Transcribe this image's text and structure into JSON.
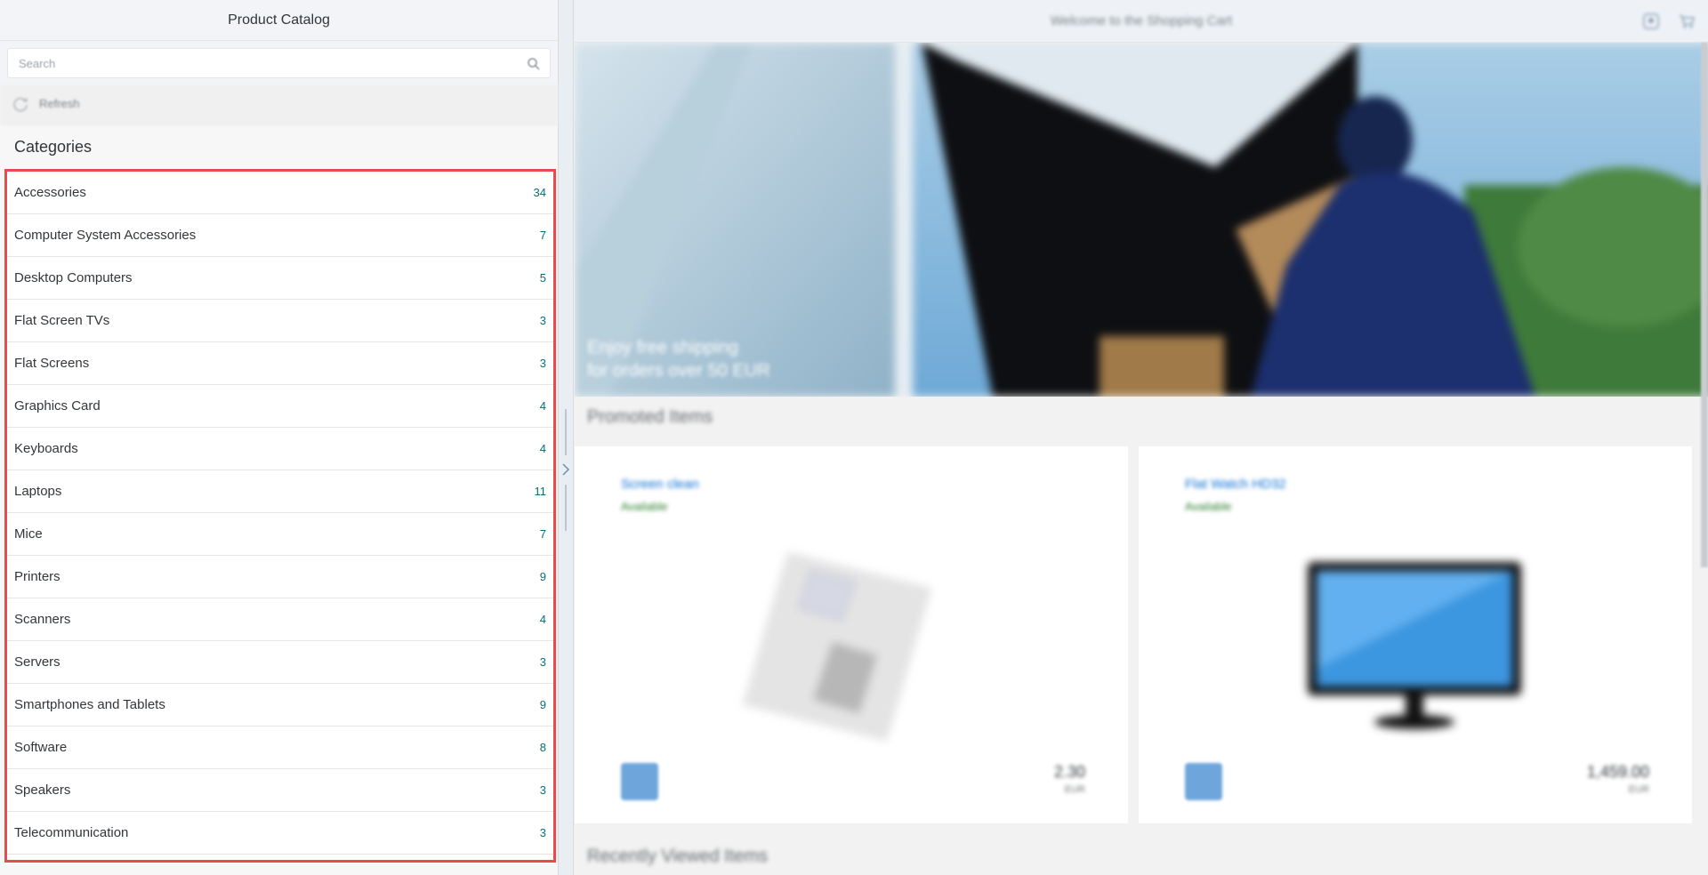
{
  "master": {
    "title": "Product Catalog",
    "search_placeholder": "Search",
    "refresh_label": "Refresh",
    "categories_title": "Categories",
    "categories": [
      {
        "name": "Accessories",
        "count": "34"
      },
      {
        "name": "Computer System Accessories",
        "count": "7"
      },
      {
        "name": "Desktop Computers",
        "count": "5"
      },
      {
        "name": "Flat Screen TVs",
        "count": "3"
      },
      {
        "name": "Flat Screens",
        "count": "3"
      },
      {
        "name": "Graphics Card",
        "count": "4"
      },
      {
        "name": "Keyboards",
        "count": "4"
      },
      {
        "name": "Laptops",
        "count": "11"
      },
      {
        "name": "Mice",
        "count": "7"
      },
      {
        "name": "Printers",
        "count": "9"
      },
      {
        "name": "Scanners",
        "count": "4"
      },
      {
        "name": "Servers",
        "count": "3"
      },
      {
        "name": "Smartphones and Tablets",
        "count": "9"
      },
      {
        "name": "Software",
        "count": "8"
      },
      {
        "name": "Speakers",
        "count": "3"
      },
      {
        "name": "Telecommunication",
        "count": "3"
      }
    ]
  },
  "detail": {
    "title": "Welcome to the Shopping Cart",
    "hero_text_line1": "Enjoy free shipping",
    "hero_text_line2": "for orders over 50 EUR",
    "promoted_title": "Promoted Items",
    "recent_title": "Recently Viewed Items",
    "cards": [
      {
        "title": "Screen clean",
        "status": "Available",
        "price": "2.30",
        "currency": "EUR"
      },
      {
        "title": "Flat Watch HD32",
        "status": "Available",
        "price": "1,459.00",
        "currency": "EUR"
      }
    ]
  },
  "colors": {
    "highlight_border": "#e74c4c",
    "count_text": "#0a6e6e",
    "link": "#0a6ed1",
    "status_success": "#2b7d2b"
  },
  "icons": [
    "search-icon",
    "refresh-icon",
    "chevron-right-icon",
    "account-icon",
    "cart-icon"
  ]
}
